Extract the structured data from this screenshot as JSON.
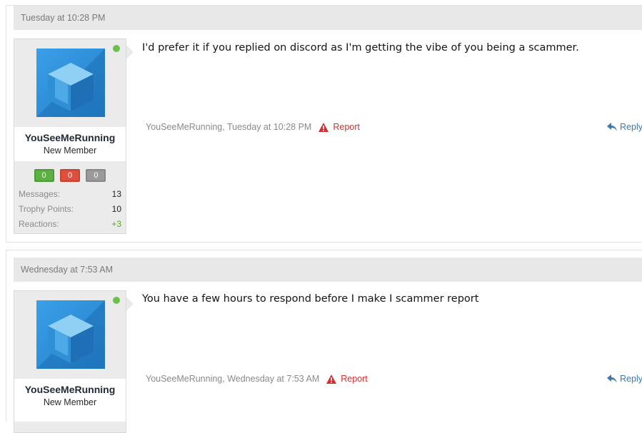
{
  "posts": [
    {
      "date": "Tuesday at 10:28 PM",
      "username": "YouSeeMeRunning",
      "user_title": "New Member",
      "ratings": [
        "0",
        "0",
        "0"
      ],
      "stats": [
        {
          "label": "Messages:",
          "value": "13"
        },
        {
          "label": "Trophy Points:",
          "value": "10"
        },
        {
          "label": "Reactions:",
          "value": "+3"
        }
      ],
      "message": "I'd prefer it if you replied on discord as I'm getting the vibe of you being a scammer.",
      "meta": "YouSeeMeRunning, Tuesday at 10:28 PM",
      "report_label": "Report",
      "reply_label": "Reply"
    },
    {
      "date": "Wednesday at 7:53 AM",
      "username": "YouSeeMeRunning",
      "user_title": "New Member",
      "message": "You have a few hours to respond before I make I scammer report",
      "meta": "YouSeeMeRunning, Wednesday at 7:53 AM",
      "report_label": "Report",
      "reply_label": "Reply"
    }
  ],
  "colors": {
    "rating_positive": "#5cb044",
    "rating_negative": "#e04e3c",
    "rating_neutral": "#9a9a9a",
    "online": "#6cc04a",
    "report": "#d32f2f",
    "reply": "#3a78b5"
  },
  "icons": {
    "avatar": "blue-cube-avatar",
    "report": "warning-triangle-icon",
    "reply": "reply-arrow-icon",
    "online": "online-status-dot"
  }
}
